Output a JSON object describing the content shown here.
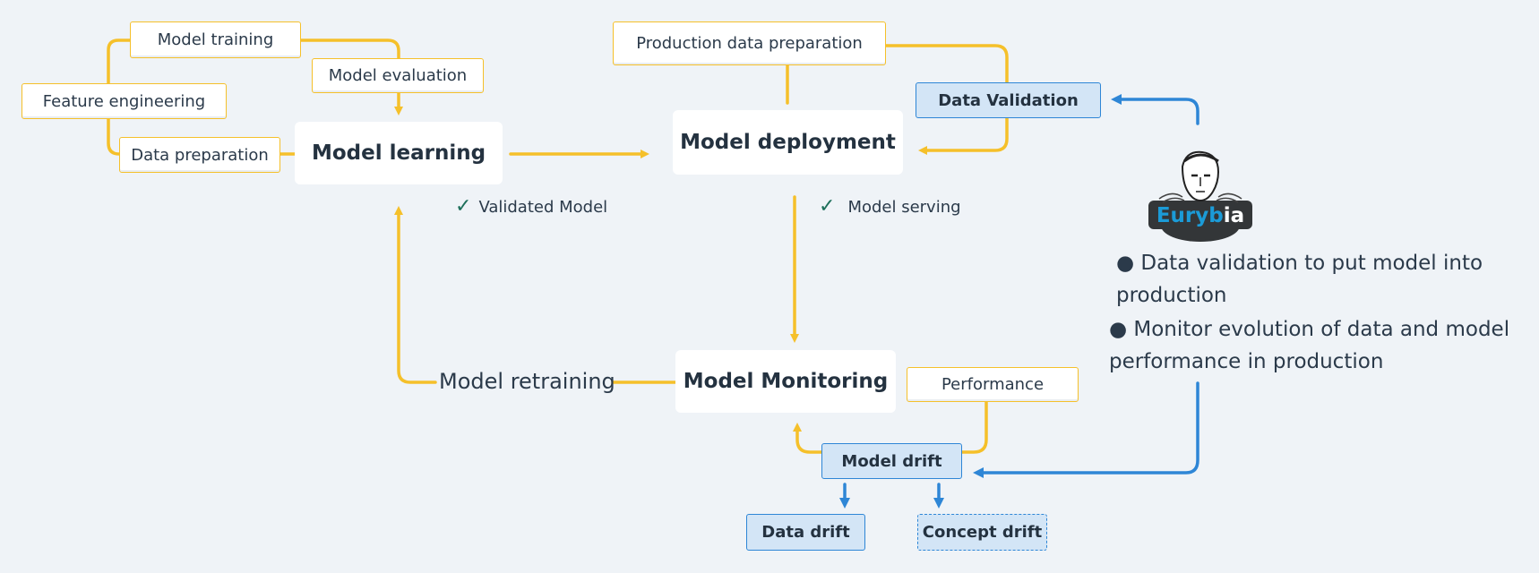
{
  "colors": {
    "background": "#eff3f7",
    "flow_yellow": "#f5c02a",
    "validation_blue": "#2e86d6",
    "blue_fill": "#d3e5f6",
    "check_green": "#1d6f5a",
    "text": "#2b3a4a"
  },
  "learning_phase": {
    "main_node": "Model learning",
    "steps": {
      "model_training": "Model training",
      "model_evaluation": "Model evaluation",
      "feature_engineering": "Feature engineering",
      "data_preparation": "Data preparation"
    },
    "outcome": "Validated Model",
    "outcome_icon": "check-icon"
  },
  "deployment_phase": {
    "main_node": "Model deployment",
    "steps": {
      "production_data_preparation": "Production data preparation",
      "data_validation": "Data Validation"
    },
    "outcome": "Model serving",
    "outcome_icon": "check-icon"
  },
  "monitoring_phase": {
    "main_node": "Model Monitoring",
    "retraining": "Model retraining",
    "performance": "Performance",
    "model_drift": "Model drift",
    "data_drift": "Data drift",
    "concept_drift": "Concept drift"
  },
  "eurybia": {
    "logo_text_blue": "Euryb",
    "logo_text_white": "ia",
    "bullets": [
      "● Data validation to put model into production",
      "● Monitor evolution of data and model performance in production"
    ]
  }
}
